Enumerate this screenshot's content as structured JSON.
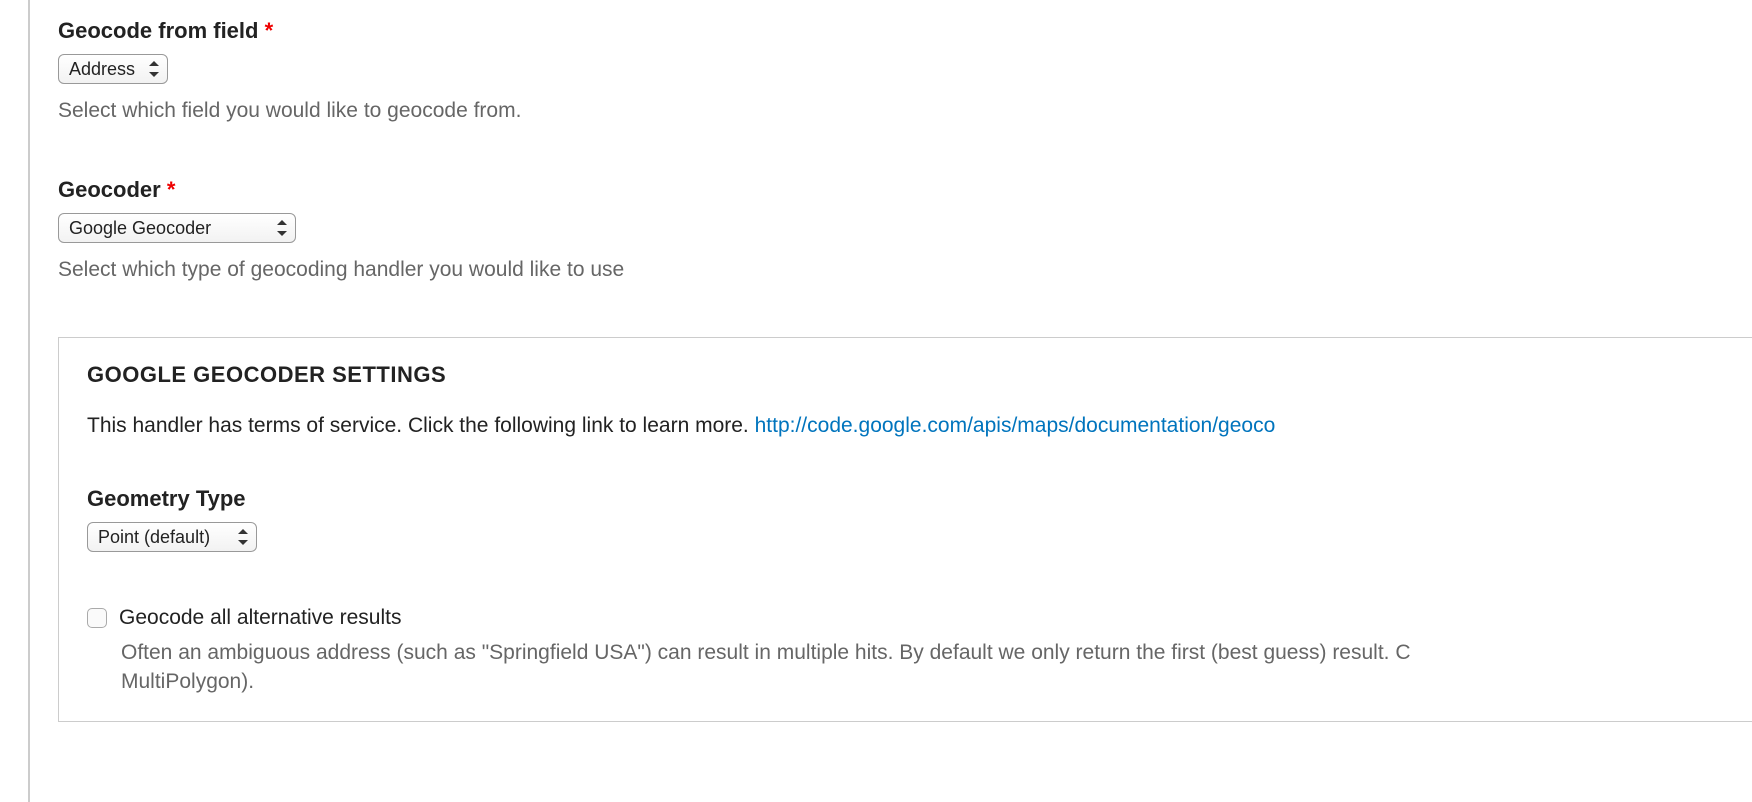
{
  "fields": {
    "geocode_from": {
      "label": "Geocode from field",
      "required_mark": "*",
      "selected": "Address",
      "help": "Select which field you would like to geocode from."
    },
    "geocoder": {
      "label": "Geocoder",
      "required_mark": "*",
      "selected": "Google Geocoder",
      "help": "Select which type of geocoding handler you would like to use"
    }
  },
  "settings_panel": {
    "legend": "GOOGLE GEOCODER SETTINGS",
    "tos_prefix": "This handler has terms of service. Click the following link to learn more. ",
    "tos_link": "http://code.google.com/apis/maps/documentation/geoco",
    "geometry_type": {
      "label": "Geometry Type",
      "selected": "Point (default)"
    },
    "alt_results": {
      "label": "Geocode all alternative results",
      "help_line1": "Often an ambiguous address (such as \"Springfield USA\") can result in multiple hits. By default we only return the first (best guess) result. C",
      "help_line2": "MultiPolygon)."
    }
  }
}
